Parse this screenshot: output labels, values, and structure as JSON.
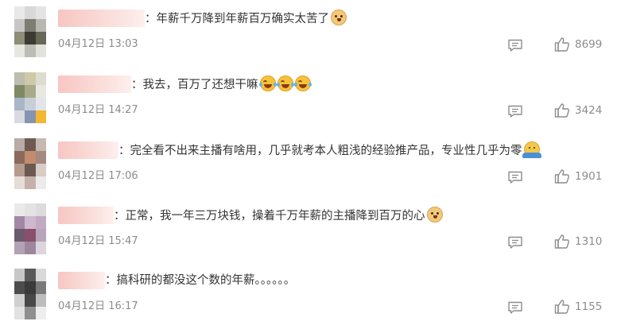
{
  "comments": [
    {
      "text": "：年薪千万降到年薪百万确实太苦了",
      "emojis": [
        "doge"
      ],
      "time": "04月12日 13:03",
      "likes": "8699",
      "avatar_colors": [
        "#e9e9e9",
        "#d8d8d8",
        "#e4e4e4",
        "#c6c6c6",
        "#7d7d72",
        "#b8b8b0",
        "#8d8d78",
        "#3b3b33",
        "#686858",
        "#e7e7e2",
        "#bdbdb5",
        "#e2e2dd"
      ]
    },
    {
      "text": "：我去，百万了还想干嘛",
      "emojis": [
        "laugh",
        "laugh",
        "laugh"
      ],
      "time": "04月12日 14:27",
      "likes": "3424",
      "avatar_colors": [
        "#bdbdb0",
        "#cfc9a6",
        "#dcdccf",
        "#7f8a62",
        "#a7ab8b",
        "#e8e8e0",
        "#a9b5c8",
        "#c9cfd8",
        "#e2e5ea",
        "#d8dbe2",
        "#8595b0",
        "#f3b733"
      ]
    },
    {
      "text": "：完全看不出来主播有啥用，几乎就考本人粗浅的经验推产品，专业性几乎为零",
      "emojis": [
        "shrug"
      ],
      "time": "04月12日 17:06",
      "likes": "1901",
      "avatar_colors": [
        "#b8aca6",
        "#6f5a52",
        "#c6b9b0",
        "#8a6a5c",
        "#c28d6e",
        "#a48a7f",
        "#b59a8e",
        "#6b5850",
        "#d8ccc6",
        "#e6dcd8",
        "#c4b2aa",
        "#ecebea"
      ]
    },
    {
      "text": "：正常，我一年三万块钱，操着千万年薪的主播降到百万的心",
      "emojis": [
        "doge"
      ],
      "time": "04月12日 15:47",
      "likes": "1310",
      "avatar_colors": [
        "#eaeaea",
        "#e3e3e3",
        "#dcdcdc",
        "#a487a6",
        "#cdb9cd",
        "#c2a9c4",
        "#6a5a6e",
        "#8a4f6a",
        "#b7a6b9",
        "#b2a2b6",
        "#9c879f",
        "#ddd4de"
      ]
    },
    {
      "text": "：搞科研的都没这个数的年薪。。。。。。",
      "emojis": [],
      "time": "04月12日 16:17",
      "likes": "1155",
      "avatar_colors": [
        "#c7c7c7",
        "#5a5a5a",
        "#d9d9d9",
        "#4c4c4c",
        "#3a3a3a",
        "#7a7a7a",
        "#cfcfcf",
        "#484848",
        "#bdbdbd",
        "#e2e2e2",
        "#8f8f8f",
        "#ededed"
      ]
    }
  ]
}
